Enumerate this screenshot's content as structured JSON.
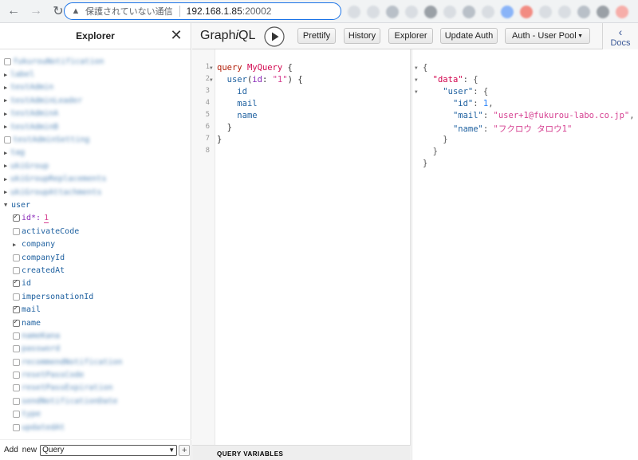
{
  "browser": {
    "back_glyph": "←",
    "forward_glyph": "→",
    "reload_glyph": "↻",
    "warning_glyph": "▲",
    "warning_text": "保護されていない通信",
    "host": "192.168.1.85",
    "port": ":20002"
  },
  "explorer": {
    "title": "Explorer",
    "close_glyph": "✕",
    "blurred_fields": [
      "fukurouNotification",
      "label",
      "testAdmin",
      "testAdminLeader",
      "testAdminA",
      "testAdminB",
      "testAdminSetting",
      "tag",
      "ukiGroup",
      "ukiGroupReplacements",
      "ukiGroupAttachments"
    ],
    "user_field": "user",
    "user_arg_name": "id*:",
    "user_arg_value": "1",
    "user_children": [
      {
        "name": "activateCode",
        "checked": false,
        "expandable": false
      },
      {
        "name": "company",
        "checked": false,
        "expandable": true
      },
      {
        "name": "companyId",
        "checked": false,
        "expandable": false
      },
      {
        "name": "createdAt",
        "checked": false,
        "expandable": false
      },
      {
        "name": "id",
        "checked": true,
        "expandable": false
      },
      {
        "name": "impersonationId",
        "checked": false,
        "expandable": false
      },
      {
        "name": "mail",
        "checked": true,
        "expandable": false
      },
      {
        "name": "name",
        "checked": true,
        "expandable": false
      }
    ],
    "blurred_user_children": [
      "nameKana",
      "password",
      "recommendNotification",
      "resetPassCode",
      "resetPassExpiration",
      "sendNotificationDate",
      "type",
      "updatedAt"
    ],
    "footer": {
      "add_label": "Add",
      "new_label": "new",
      "selected_operation": "Query",
      "plus_label": "+"
    }
  },
  "toolbar": {
    "title_a": "Graph",
    "title_i": "i",
    "title_b": "QL",
    "buttons": [
      "Prettify",
      "History",
      "Explorer",
      "Update Auth",
      "Auth - User Pool"
    ],
    "auth_dropdown_glyph": "▼",
    "docs_label": "Docs",
    "docs_glyph": "‹"
  },
  "editor": {
    "line_numbers": [
      "1",
      "2",
      "3",
      "4",
      "5",
      "6",
      "7",
      "8"
    ],
    "query_keyword": "query",
    "operation_name": "MyQuery",
    "field_user": "user",
    "arg_name": "id",
    "arg_value": "\"1\"",
    "selected_fields": [
      "id",
      "mail",
      "name"
    ],
    "variables_label": "QUERY VARIABLES"
  },
  "result": {
    "data_key": "\"data\"",
    "user_key": "\"user\"",
    "id_key": "\"id\"",
    "id_value": "1",
    "mail_key": "\"mail\"",
    "mail_value": "\"user+1@fukurou-labo.co.jp\"",
    "name_key": "\"name\"",
    "name_value": "\"フクロウ タロウ1\""
  },
  "colors": {
    "accent": "#1a73e8",
    "keyword": "#b11a04",
    "definition": "#d2054e",
    "property": "#1f61a0",
    "string": "#d64292"
  }
}
